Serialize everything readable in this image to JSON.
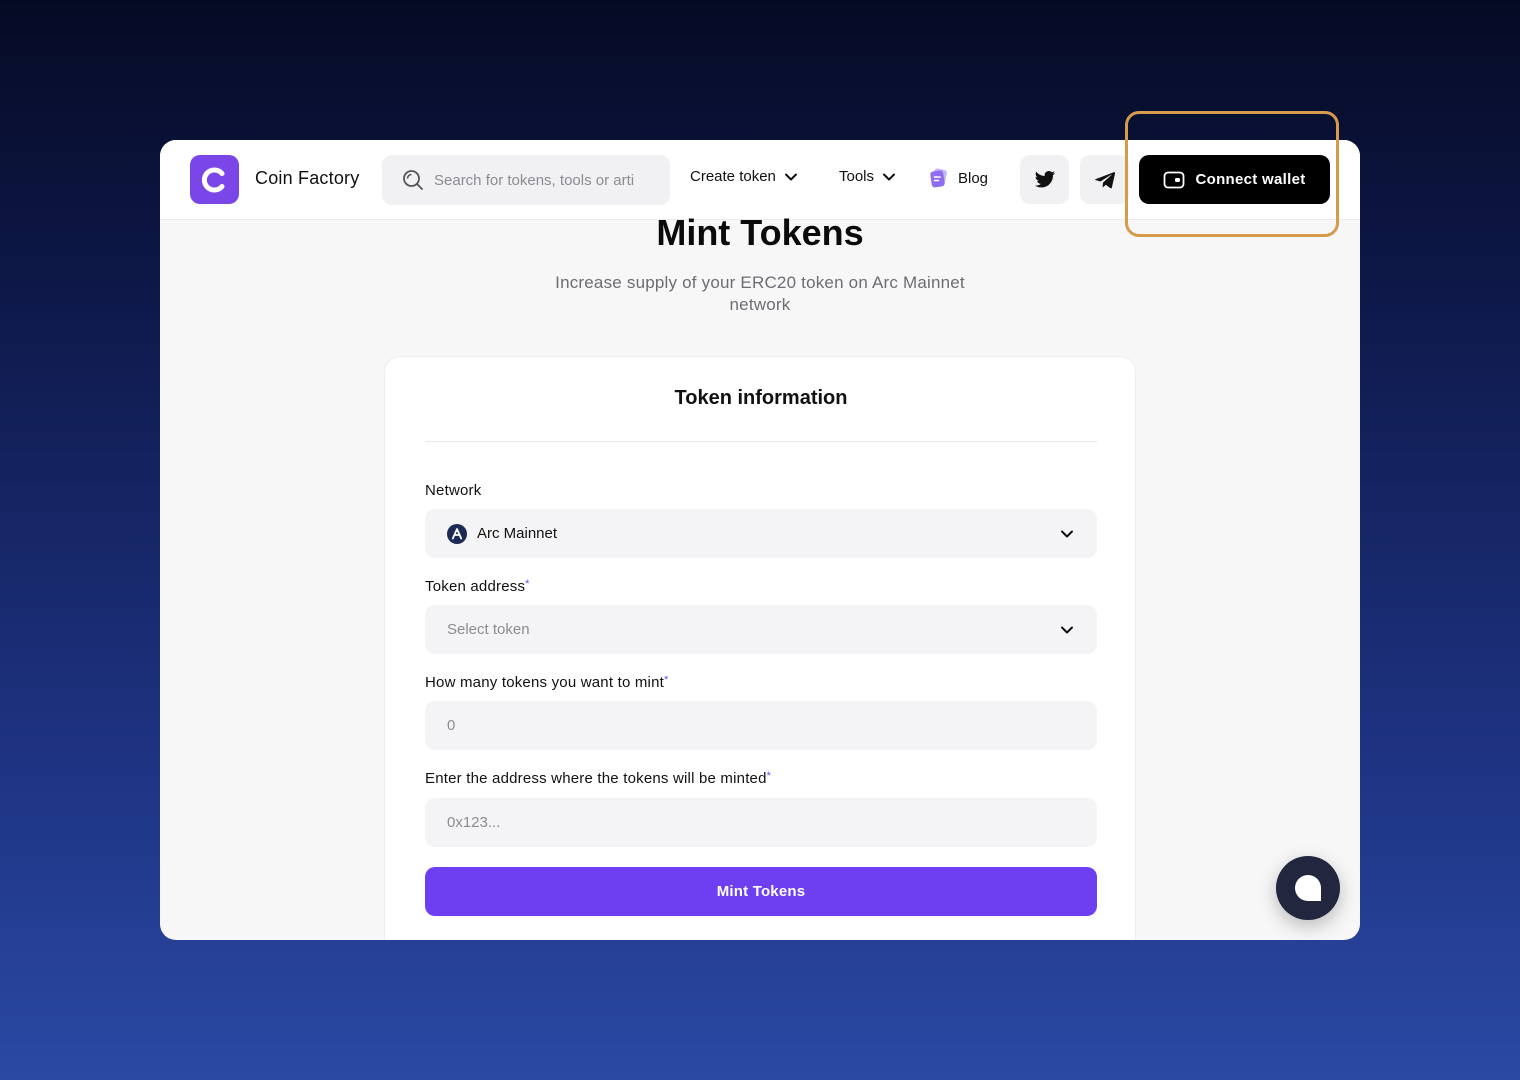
{
  "navbar": {
    "brand": "Coin Factory",
    "search_placeholder": "Search for tokens, tools or arti",
    "create_token": "Create token",
    "tools": "Tools",
    "blog": "Blog",
    "connect_wallet": "Connect wallet"
  },
  "page": {
    "title": "Mint Tokens",
    "subtitle": "Increase supply of your ERC20 token on Arc Mainnet network"
  },
  "form": {
    "card_title": "Token information",
    "network_label": "Network",
    "network_value": "Arc Mainnet",
    "token_address_label": "Token address",
    "token_address_placeholder": "Select token",
    "amount_label": "How many tokens you want to mint",
    "amount_placeholder": "0",
    "mint_address_label": "Enter the address where the tokens will be minted",
    "mint_address_placeholder": "0x123...",
    "required_mark": "*",
    "submit_label": "Mint Tokens"
  },
  "colors": {
    "accent": "#6d3ff0",
    "logo": "#7b46e8",
    "highlight": "#d69c4e"
  }
}
